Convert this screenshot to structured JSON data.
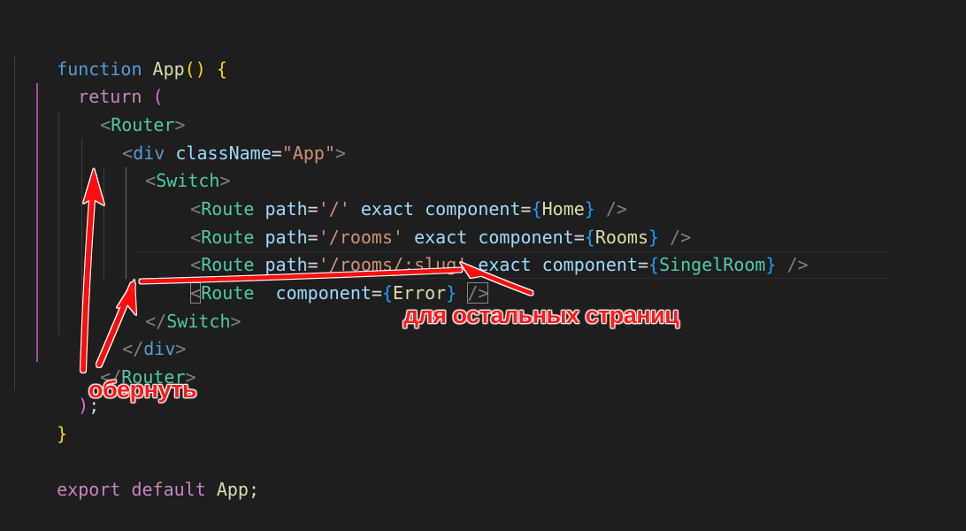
{
  "code": {
    "kw_function": "function",
    "fn_app": "App",
    "paren_open": "(",
    "paren_close": ")",
    "brace_open": "{",
    "brace_close": "}",
    "kw_return": "return",
    "return_paren": "(",
    "lt": "<",
    "gt": ">",
    "lt_slash": "</",
    "self_close": "/>",
    "tag_router": "Router",
    "tag_div": "div",
    "tag_switch": "Switch",
    "tag_route": "Route",
    "attr_classname": "className",
    "attr_path": "path",
    "attr_exact": "exact",
    "attr_component": "component",
    "eq": "=",
    "str_app": "\"App\"",
    "str_root": "'/'",
    "str_rooms": "'/rooms'",
    "str_rooms_slug": "'/rooms/:slug'",
    "comp_home": "Home",
    "comp_rooms": "Rooms",
    "comp_singelroom": "SingelRoom",
    "comp_error": "Error",
    "close_paren_semi": ");",
    "semicolon": ";",
    "kw_export": "export",
    "kw_default": "default",
    "export_app": "App"
  },
  "annotations": {
    "other_pages": "для остальных страниц",
    "wrap": "обернуть"
  },
  "colors": {
    "background": "#1e1e1e",
    "annotation": "#ff1a1a"
  }
}
